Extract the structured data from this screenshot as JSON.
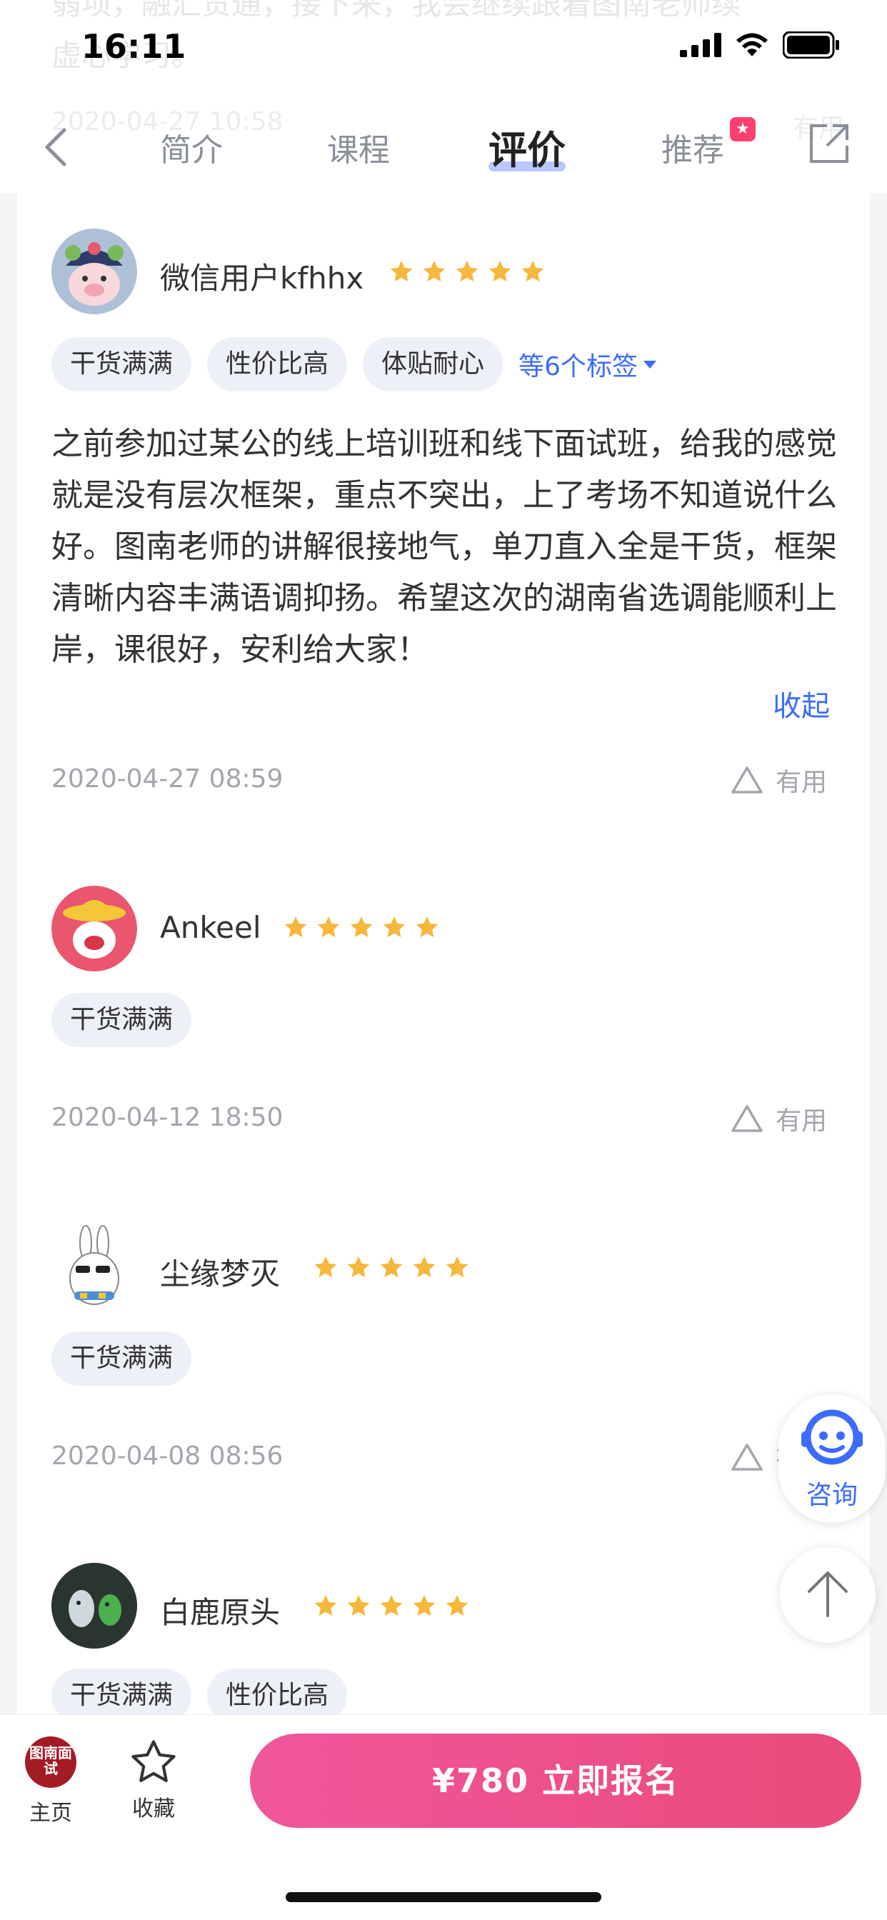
{
  "status_bar": {
    "time": "16:11"
  },
  "ghost": {
    "text": "弱项，融汇贯通，接下来，我会继续跟着图南老师续",
    "text2": "虚心学习。",
    "date": "2020-04-27 10:58",
    "useful": "有用"
  },
  "tabs": {
    "intro": "简介",
    "course": "课程",
    "review": "评价",
    "recommend": "推荐"
  },
  "reviews": [
    {
      "username": "微信用户kfhhx",
      "rating": 5,
      "tags": [
        "干货满满",
        "性价比高",
        "体贴耐心"
      ],
      "more_tags": "等6个标签",
      "text": "之前参加过某公的线上培训班和线下面试班，给我的感觉就是没有层次框架，重点不突出，上了考场不知道说什么好。图南老师的讲解很接地气，单刀直入全是干货，框架清晰内容丰满语调抑扬。希望这次的湖南省选调能顺利上岸，课很好，安利给大家！",
      "collapse": "收起",
      "date": "2020-04-27 08:59",
      "useful": "有用"
    },
    {
      "username": "Ankeel",
      "rating": 5,
      "tags": [
        "干货满满"
      ],
      "date": "2020-04-12 18:50",
      "useful": "有用"
    },
    {
      "username": "尘缘梦灭",
      "rating": 5,
      "tags": [
        "干货满满"
      ],
      "date": "2020-04-08 08:56",
      "useful": "有用"
    },
    {
      "username": "白鹿原头",
      "rating": 5,
      "tags": [
        "干货满满",
        "性价比高"
      ]
    }
  ],
  "floating": {
    "consult": "咨询"
  },
  "bottom_bar": {
    "home_logo": "图南面试",
    "home": "主页",
    "favorite": "收藏",
    "buy": "¥780  立即报名"
  },
  "colors": {
    "accent": "#3b6cff",
    "star": "#f5b83c",
    "buy_start": "#f0569b",
    "buy_end": "#ea4b7a"
  }
}
